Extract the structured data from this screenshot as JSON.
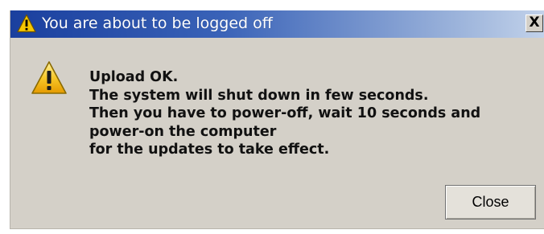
{
  "dialog": {
    "title": "You are about to be logged off",
    "close_glyph": "X",
    "title_icon": "warning-icon",
    "message_icon": "warning-icon",
    "message_lines": [
      "Upload OK.",
      "The system will shut down in few seconds.",
      "Then you have to power-off, wait 10 seconds and",
      "power-on the computer",
      "for the updates to take effect."
    ],
    "close_button_label": "Close"
  },
  "colors": {
    "titlebar_start": "#1a3f9e",
    "titlebar_end": "#c2d2ea",
    "dialog_background": "#d4d0c8",
    "warning_yellow": "#f5c518"
  }
}
